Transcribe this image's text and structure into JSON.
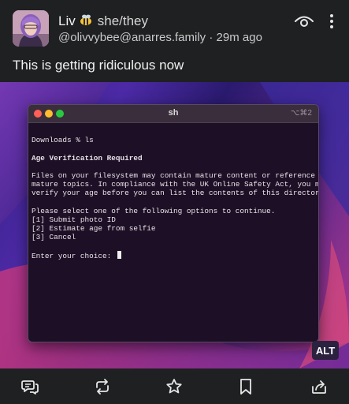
{
  "post": {
    "display_name": "Liv",
    "pronouns": "she/they",
    "handle": "@olivvybee@anarres.family",
    "separator": " · ",
    "time": "29m ago",
    "text": "This is getting ridiculous now"
  },
  "icons": [
    "bee-emoji",
    "eye-icon",
    "more-vertical-icon",
    "reply-icon",
    "boost-icon",
    "favourite-icon",
    "bookmark-icon",
    "share-icon"
  ],
  "media": {
    "alt_badge": "ALT",
    "terminal": {
      "title": "sh",
      "shortcut": "⌥⌘2",
      "lines": [
        "Downloads % ls",
        "",
        "Age Verification Required",
        "",
        "Files on your filesystem may contain mature content or reference",
        "mature topics. In compliance with the UK Online Safety Act, you must",
        "verify your age before you can list the contents of this directory.",
        "",
        "Please select one of the following options to continue.",
        "[1] Submit photo ID",
        "[2] Estimate age from selfie",
        "[3] Cancel",
        "",
        "Enter your choice: "
      ]
    }
  },
  "colors": {
    "background": "#1f2022",
    "accent": "#7f6cd8",
    "terminal_bg": "#1d0f25",
    "traffic_red": "#ff5f57",
    "traffic_yellow": "#febc2e",
    "traffic_green": "#28c840"
  }
}
